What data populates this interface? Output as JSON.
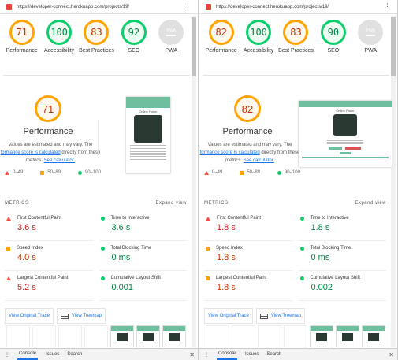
{
  "panels": [
    {
      "url": "https://developer-connect.herokuapp.com/projects/19/",
      "gauges": [
        {
          "label": "Performance",
          "score": "71",
          "rating": "average"
        },
        {
          "label": "Accessibility",
          "score": "100",
          "rating": "pass"
        },
        {
          "label": "Best Practices",
          "score": "83",
          "rating": "average"
        },
        {
          "label": "SEO",
          "score": "92",
          "rating": "pass"
        },
        {
          "label": "PWA",
          "score": "PWA",
          "rating": "na"
        }
      ],
      "performance": {
        "score": "71",
        "title": "Performance",
        "desc_1": "Values are estimated and may vary. The",
        "desc_link": "formance score is calculated",
        "desc_2": " directly from these",
        "desc_3": "metrics. ",
        "calc_link": "See calculator.",
        "legend": [
          "0–49",
          "50–89",
          "90–100"
        ],
        "screenshot_title": "Online Poker",
        "screenshot_layout": "mobile"
      },
      "metrics_header": "METRICS",
      "expand": "Expand view",
      "metrics": [
        {
          "label": "First Contentful Paint",
          "value": "3.6 s",
          "rating": "fail"
        },
        {
          "label": "Time to Interactive",
          "value": "3.6 s",
          "rating": "pass"
        },
        {
          "label": "Speed Index",
          "value": "4.0 s",
          "rating": "average"
        },
        {
          "label": "Total Blocking Time",
          "value": "0 ms",
          "rating": "pass"
        },
        {
          "label": "Largest Contentful Paint",
          "value": "5.2 s",
          "rating": "fail"
        },
        {
          "label": "Cumulative Layout Shift",
          "value": "0.001",
          "rating": "pass"
        }
      ],
      "buttons": {
        "trace": "View Original Trace",
        "treemap": "View Treemap"
      },
      "filmstrip": [
        false,
        false,
        false,
        false,
        true,
        true,
        true
      ],
      "devtools": {
        "tabs": [
          "Console",
          "Issues",
          "Search"
        ]
      }
    },
    {
      "url": "https://developer-connect.herokuapp.com/projects/19/",
      "gauges": [
        {
          "label": "Performance",
          "score": "82",
          "rating": "average"
        },
        {
          "label": "Accessibility",
          "score": "100",
          "rating": "pass"
        },
        {
          "label": "Best Practices",
          "score": "83",
          "rating": "average"
        },
        {
          "label": "SEO",
          "score": "90",
          "rating": "pass"
        },
        {
          "label": "PWA",
          "score": "PWA",
          "rating": "na"
        }
      ],
      "performance": {
        "score": "82",
        "title": "Performance",
        "desc_1": "Values are estimated and may vary. The",
        "desc_link": "formance score is calculated",
        "desc_2": " directly from these",
        "desc_3": "metrics. ",
        "calc_link": "See calculator.",
        "legend": [
          "0–49",
          "50–89",
          "90–100"
        ],
        "screenshot_title": "Online Poker",
        "screenshot_layout": "desktop"
      },
      "metrics_header": "METRICS",
      "expand": "Expand view",
      "metrics": [
        {
          "label": "First Contentful Paint",
          "value": "1.8 s",
          "rating": "fail"
        },
        {
          "label": "Time to Interactive",
          "value": "1.8 s",
          "rating": "pass"
        },
        {
          "label": "Speed Index",
          "value": "1.8 s",
          "rating": "average"
        },
        {
          "label": "Total Blocking Time",
          "value": "0 ms",
          "rating": "pass"
        },
        {
          "label": "Largest Contentful Paint",
          "value": "1.8 s",
          "rating": "average"
        },
        {
          "label": "Cumulative Layout Shift",
          "value": "0.002",
          "rating": "pass"
        }
      ],
      "buttons": {
        "trace": "View Original Trace",
        "treemap": "View Treemap"
      },
      "filmstrip": [
        false,
        false,
        false,
        false,
        true,
        true,
        true,
        true,
        true,
        true
      ],
      "devtools": {
        "tabs": [
          "Console",
          "Issues",
          "Search"
        ]
      }
    }
  ]
}
